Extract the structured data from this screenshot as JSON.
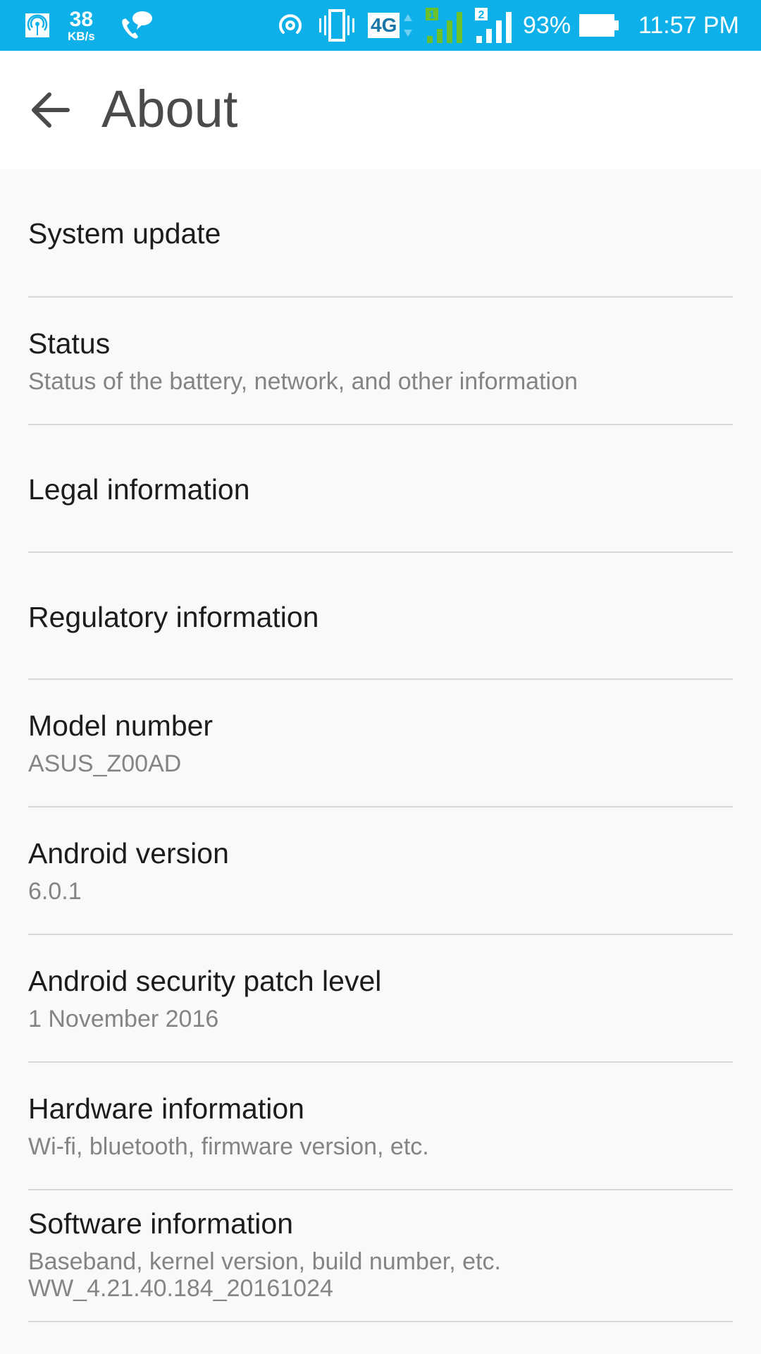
{
  "status_bar": {
    "network_speed_value": "38",
    "network_speed_unit": "KB/s",
    "network_type": "4G",
    "sim1_label": "1",
    "sim2_label": "2",
    "battery_percent": "93%",
    "battery_level": 0.93,
    "time": "11:57 PM",
    "colors": {
      "background": "#0eb0e9",
      "sim1": "#6cc12a"
    }
  },
  "toolbar": {
    "title": "About"
  },
  "items": [
    {
      "title": "System update",
      "summary": ""
    },
    {
      "title": "Status",
      "summary": "Status of the battery, network, and other information"
    },
    {
      "title": "Legal information",
      "summary": ""
    },
    {
      "title": "Regulatory information",
      "summary": ""
    },
    {
      "title": "Model number",
      "summary": "ASUS_Z00AD"
    },
    {
      "title": "Android version",
      "summary": "6.0.1"
    },
    {
      "title": "Android security patch level",
      "summary": "1 November 2016"
    },
    {
      "title": "Hardware information",
      "summary": "Wi-fi, bluetooth, firmware version, etc."
    },
    {
      "title": "Software information",
      "summary": "Baseband, kernel version, build number, etc.",
      "summary2": "WW_4.21.40.184_20161024"
    }
  ]
}
